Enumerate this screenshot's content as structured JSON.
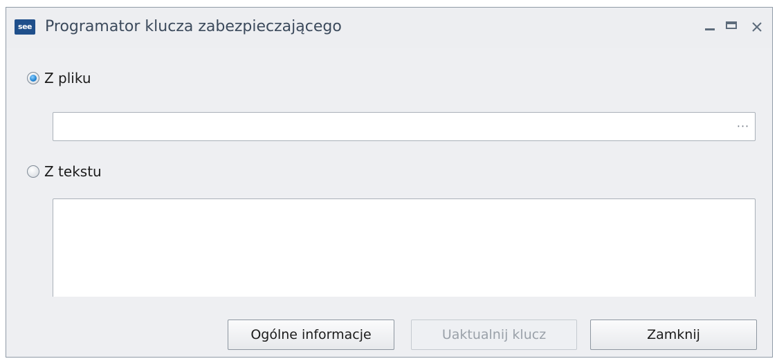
{
  "window": {
    "title": "Programator klucza zabezpieczającego",
    "icon_text": "see",
    "icon_name": "app-logo-icon"
  },
  "source": {
    "from_file_label": "Z pliku",
    "from_file_selected": true,
    "file_path_value": "",
    "browse_label": "···",
    "from_text_label": "Z tekstu",
    "from_text_selected": false,
    "text_value": ""
  },
  "buttons": {
    "info_label": "Ogólne informacje",
    "update_label": "Uaktualnij klucz",
    "update_enabled": false,
    "close_label": "Zamknij"
  },
  "colors": {
    "window_bg": "#eeeff2",
    "accent_radio": "#2a8ad6",
    "title_text": "#3c4a5c",
    "disabled_text": "#9aa1a9"
  }
}
